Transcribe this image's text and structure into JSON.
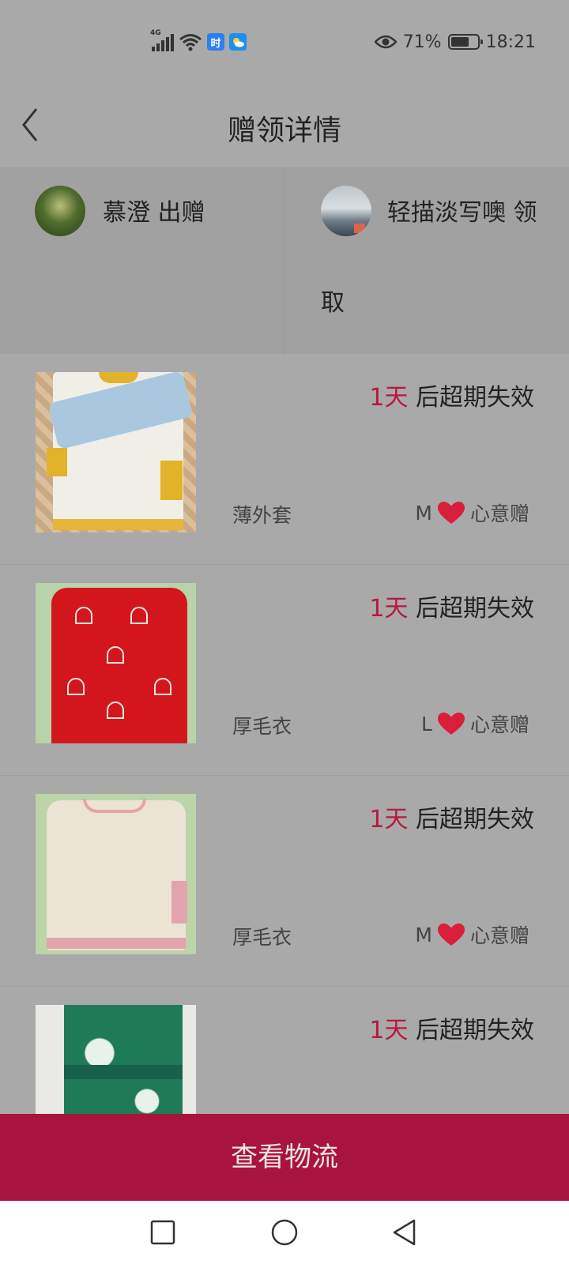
{
  "status_bar": {
    "network_label": "4G",
    "app_badge_time": "时",
    "battery_percent": "71%",
    "battery_level": 0.71,
    "time": "18:21"
  },
  "header": {
    "title": "赠领详情"
  },
  "parties": {
    "giver": {
      "name": "慕澄 出赠"
    },
    "receiver": {
      "name_line1": "轻描淡写噢 领",
      "name_line2": "取"
    }
  },
  "items": [
    {
      "days": "1天",
      "expire_suffix": " 后超期失效",
      "name": "薄外套",
      "size": "M",
      "tag": "心意赠"
    },
    {
      "days": "1天",
      "expire_suffix": " 后超期失效",
      "name": "厚毛衣",
      "size": "L",
      "tag": "心意赠"
    },
    {
      "days": "1天",
      "expire_suffix": " 后超期失效",
      "name": "厚毛衣",
      "size": "M",
      "tag": "心意赠"
    },
    {
      "days": "1天",
      "expire_suffix": " 后超期失效",
      "name": "",
      "size": "",
      "tag": ""
    }
  ],
  "actions": {
    "view_logistics": "查看物流"
  },
  "colors": {
    "accent": "#a8143b",
    "days_red": "#b8183f",
    "heart_red": "#d81e3a"
  },
  "icons": {
    "back": "chevron-left-icon",
    "heart": "heart-icon",
    "nav_recent": "square-icon",
    "nav_home": "circle-icon",
    "nav_back": "triangle-back-icon"
  }
}
